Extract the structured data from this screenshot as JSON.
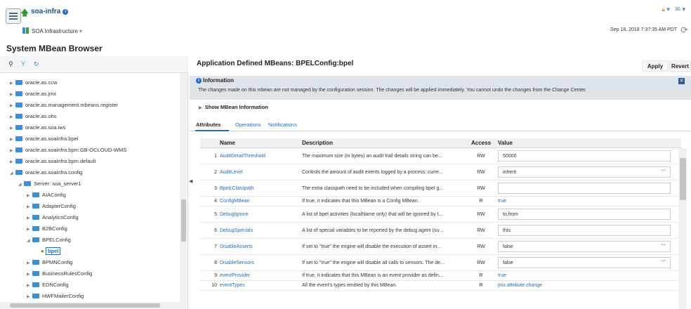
{
  "header": {
    "title": "soa-infra",
    "subtitle": "SOA Infrastructure",
    "timestamp": "Sep 18, 2018 7:37:35 AM PDT",
    "icons": [
      "lock-icon",
      "mail-icon",
      "refresh-icon"
    ]
  },
  "page": {
    "title": "System MBean Browser"
  },
  "tree": {
    "items": [
      {
        "label": "oracle.as.ccw",
        "expanded": false
      },
      {
        "label": "oracle.as.jmx",
        "expanded": false
      },
      {
        "label": "oracle.as.management.mbeans.register",
        "expanded": false
      },
      {
        "label": "oracle.as.ohs",
        "expanded": false
      },
      {
        "label": "oracle.as.soa.iws",
        "expanded": false
      },
      {
        "label": "oracle.as.soainfra.bpel",
        "expanded": false
      },
      {
        "label": "oracle.as.soainfra.bpm.GB-OCLOUD-WMS",
        "expanded": false
      },
      {
        "label": "oracle.as.soainfra.bpm.default",
        "expanded": false
      },
      {
        "label": "oracle.as.soainfra.config",
        "expanded": true
      },
      {
        "label": "Server: soa_server1",
        "expanded": true
      },
      {
        "label": "AIAConfig",
        "expanded": false
      },
      {
        "label": "AdapterConfig",
        "expanded": false
      },
      {
        "label": "AnalyticsConfig",
        "expanded": false
      },
      {
        "label": "B2BConfig",
        "expanded": false
      },
      {
        "label": "BPELConfig",
        "expanded": true
      },
      {
        "label": "bpel",
        "selected": true
      },
      {
        "label": "BPMNConfig",
        "expanded": false
      },
      {
        "label": "BusinessRulesConfig",
        "expanded": false
      },
      {
        "label": "EDNConfig",
        "expanded": false
      },
      {
        "label": "HWFMailerConfig",
        "expanded": false
      }
    ]
  },
  "main": {
    "title": "Application Defined MBeans: BPELConfig:bpel",
    "apply_label": "Apply",
    "revert_label": "Revert",
    "info_heading": "Information",
    "info_text": "The changes made on this mbean are not managed by the configuration session. The changes will be applied immediately. You cannot undo the changes from the Change Center.",
    "show_info_label": "Show MBean Information",
    "tabs": [
      "Attributes",
      "Operations",
      "Notifications"
    ],
    "columns": {
      "name": "Name",
      "description": "Description",
      "access": "Access",
      "value": "Value"
    },
    "rows": [
      {
        "num": "1",
        "name": "AuditDetailThreshold",
        "desc": "The maximum size (in bytes) an audit trail details string can be...",
        "access": "RW",
        "value": "50000",
        "type": "input"
      },
      {
        "num": "2",
        "name": "AuditLevel",
        "desc": "Controls the amount of audit events logged by a process; curre...",
        "access": "RW",
        "value": "inherit",
        "type": "select"
      },
      {
        "num": "3",
        "name": "BpelcClasspath",
        "desc": "The extra classpath need to be included when compiling bpel g...",
        "access": "RW",
        "value": "",
        "type": "input"
      },
      {
        "num": "4",
        "name": "ConfigMBean",
        "desc": "If true, it indicates that this MBean is a Config MBean.",
        "access": "R",
        "value": "true",
        "type": "link"
      },
      {
        "num": "5",
        "name": "DebugIgnore",
        "desc": "A list of bpel activities (localName only) that will be ignored by t...",
        "access": "RW",
        "value": "to,from",
        "type": "input"
      },
      {
        "num": "6",
        "name": "DebugSpecials",
        "desc": "A list of special variables to be reported by the debug agent (su...",
        "access": "RW",
        "value": "this",
        "type": "input"
      },
      {
        "num": "7",
        "name": "DisableAsserts",
        "desc": "If set to \"true\" the engine will disable the execution of assert in...",
        "access": "RW",
        "value": "false",
        "type": "select"
      },
      {
        "num": "8",
        "name": "DisableSensors",
        "desc": "If set to \"true\" the engine will disable all calls to sensors. The de...",
        "access": "RW",
        "value": "false",
        "type": "select"
      },
      {
        "num": "9",
        "name": "eventProvider",
        "desc": "If true, it indicates that this MBean is an event provider as defin...",
        "access": "R",
        "value": "true",
        "type": "link"
      },
      {
        "num": "10",
        "name": "eventTypes",
        "desc": "All the event's types emitted by this MBean.",
        "access": "R",
        "value": "jmx.attribute.change",
        "type": "link"
      }
    ]
  }
}
